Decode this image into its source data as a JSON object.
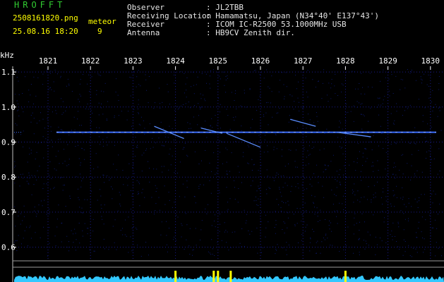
{
  "header": {
    "app_title": "HROFFT",
    "filename": "2508161820.png",
    "meteor_label": "meteor",
    "datetime": "25.08.16 18:20",
    "meteor_count": "9",
    "info": [
      {
        "label": "Observer",
        "value": ": JL2TBB"
      },
      {
        "label": "Receiving Location",
        "value": ": Hamamatsu, Japan (N34°40' E137°43')"
      },
      {
        "label": "Receiver",
        "value": ": ICOM IC-R2500 53.1000MHz USB"
      },
      {
        "label": "Antenna",
        "value": ": HB9CV Zenith dir."
      }
    ]
  },
  "chart_data": {
    "type": "heatmap",
    "ylabel": "kHz",
    "x_ticks": [
      "1821",
      "1822",
      "1823",
      "1824",
      "1825",
      "1826",
      "1827",
      "1828",
      "1829",
      "1830"
    ],
    "y_ticks": [
      "1.1",
      "1.0",
      "0.9",
      "0.8",
      "0.7",
      "0.6"
    ],
    "ylim": [
      0.58,
      1.17
    ],
    "carrier_khz": 0.928,
    "meteor_traces": [
      {
        "t0": 1823.5,
        "f0": 0.945,
        "t1": 1824.2,
        "f1": 0.91
      },
      {
        "t0": 1824.6,
        "f0": 0.94,
        "t1": 1825.1,
        "f1": 0.925
      },
      {
        "t0": 1825.2,
        "f0": 0.925,
        "t1": 1826.0,
        "f1": 0.885
      },
      {
        "t0": 1826.7,
        "f0": 0.965,
        "t1": 1827.3,
        "f1": 0.945
      },
      {
        "t0": 1827.8,
        "f0": 0.928,
        "t1": 1828.6,
        "f1": 0.915
      }
    ],
    "colors": {
      "carrier": "#3a6cff",
      "trace": "#5a8dff",
      "noise_band": "#33c8ff",
      "spike": "#ffff00",
      "grid": "#1a1a8a"
    }
  }
}
